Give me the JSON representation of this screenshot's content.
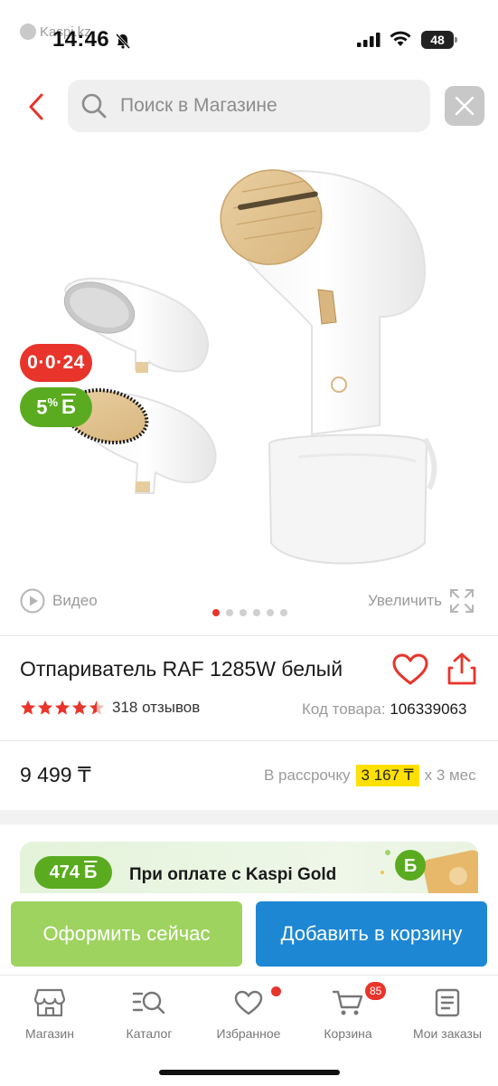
{
  "status_bar": {
    "source": "Kaspi.kz",
    "time": "14:46",
    "battery": "48"
  },
  "search": {
    "placeholder": "Поиск в Магазине"
  },
  "gallery": {
    "timer_badge": "0·0·24",
    "bonus_badge_value": "5",
    "bonus_badge_unit": "%",
    "bonus_badge_symbol": "Б",
    "video_label": "Видео",
    "zoom_label": "Увеличить",
    "slide_count": 6,
    "active_slide": 0
  },
  "product": {
    "title": "Отпариватель RAF 1285W белый",
    "rating": 4.5,
    "reviews": "318 отзывов",
    "sku_label": "Код товара:",
    "sku_value": "106339063"
  },
  "pricing": {
    "price": "9 499 ₸",
    "installment_label": "В рассрочку",
    "installment_amount": "3 167 ₸",
    "installment_term": "х 3 мес"
  },
  "promo": {
    "bonus_amount": "474",
    "bonus_symbol": "Б",
    "text": "При оплате с Kaspi Gold"
  },
  "actions": {
    "checkout_label": "Оформить сейчас",
    "add_to_cart_label": "Добавить в корзину"
  },
  "nav": {
    "items": [
      {
        "label": "Магазин",
        "icon": "store-icon"
      },
      {
        "label": "Каталог",
        "icon": "catalog-search-icon"
      },
      {
        "label": "Избранное",
        "icon": "heart-icon"
      },
      {
        "label": "Корзина",
        "icon": "cart-icon",
        "badge": "85"
      },
      {
        "label": "Мои заказы",
        "icon": "orders-icon"
      }
    ]
  },
  "colors": {
    "brand_red": "#e8342a",
    "bonus_green": "#5aab1f",
    "checkout_green": "#9ed35f",
    "cart_blue": "#1d87d4",
    "installment_yellow": "#ffe000"
  }
}
